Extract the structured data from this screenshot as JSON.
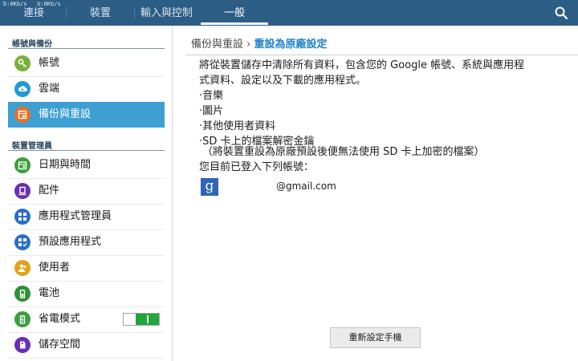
{
  "status_bar": {
    "download": "D:0Kb/s",
    "upload": "U:0Kb/s"
  },
  "tabs": [
    {
      "label": "連接"
    },
    {
      "label": "裝置"
    },
    {
      "label": "輸入與控制"
    },
    {
      "label": "一般"
    }
  ],
  "sidebar": {
    "section1": "帳號與備份",
    "items1": [
      {
        "label": "帳號",
        "icon": "key-icon",
        "color": "#78b13a"
      },
      {
        "label": "雲端",
        "icon": "cloud-icon",
        "color": "#1f9bd1"
      },
      {
        "label": "備份與重設",
        "icon": "backup-reset-icon",
        "color": "#ef6b1f"
      }
    ],
    "section2": "裝置管理員",
    "items2": [
      {
        "label": "日期與時間",
        "icon": "calendar-icon",
        "color": "#3b9e3f"
      },
      {
        "label": "配件",
        "icon": "accessory-icon",
        "color": "#6a2fb3"
      },
      {
        "label": "應用程式管理員",
        "icon": "app-grid-icon",
        "color": "#2a6fc4"
      },
      {
        "label": "預設應用程式",
        "icon": "default-apps-icon",
        "color": "#2a6fc4"
      },
      {
        "label": "使用者",
        "icon": "users-icon",
        "color": "#e2a21c"
      },
      {
        "label": "電池",
        "icon": "battery-icon",
        "color": "#2e8f3b"
      },
      {
        "label": "省電模式",
        "icon": "power-saving-icon",
        "color": "#3b9e3f",
        "toggle_on": true
      },
      {
        "label": "儲存空間",
        "icon": "storage-icon",
        "color": "#6a2fb3"
      }
    ]
  },
  "main": {
    "breadcrumb_parent": "備份與重設",
    "breadcrumb_sep": "›",
    "breadcrumb_current": "重設為原廠設定",
    "intro_line1": "將從裝置儲存中清除所有資料，包含您的 Google 帳號、系統與應用程",
    "intro_line2": "式資料、設定以及下載的應用程式。",
    "list": [
      "·音樂",
      "·圖片",
      "·其他使用者資料",
      "·SD 卡上的檔案解密金鑰"
    ],
    "sd_note": "（將裝置重設為原廠預設後便無法使用 SD 卡上加密的檔案）",
    "logged_in": "您目前已登入下列帳號：",
    "google_glyph": "g",
    "account": "@gmail.com",
    "reset_button": "重新設定手機"
  },
  "colors": {
    "topbar": "#2b5d85",
    "accent": "#1f83c8",
    "selected": "#3e9fd3"
  }
}
